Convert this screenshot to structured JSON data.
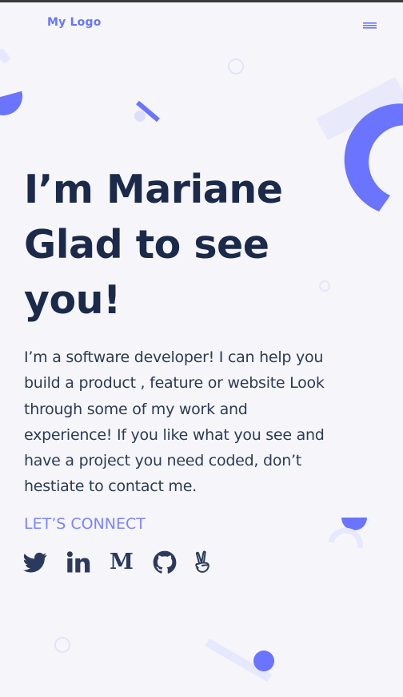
{
  "header": {
    "logo_text": "My Logo",
    "menu_icon": "hamburger-menu-icon"
  },
  "hero": {
    "title_lines": [
      "I’m Mariane",
      "Glad to see",
      "you!"
    ],
    "description_lines": [
      "I’m a software developer! I can help you",
      "build a product , feature or website Look",
      "through some of my work and",
      "experience! If you like what you see and",
      "have a project you need coded, don’t",
      "hestiate to contact me."
    ],
    "connect_label": "LET’S CONNECT"
  },
  "socials": [
    {
      "name": "twitter",
      "icon": "twitter-icon"
    },
    {
      "name": "linkedin",
      "icon": "linkedin-icon"
    },
    {
      "name": "medium",
      "icon": "medium-icon",
      "glyph": "M"
    },
    {
      "name": "github",
      "icon": "github-icon"
    },
    {
      "name": "angellist",
      "icon": "angellist-icon"
    }
  ],
  "colors": {
    "background": "#f6f6fa",
    "accent": "#6a74ff",
    "accent_light": "#e6e8fd",
    "text_dark": "#1b2a4a",
    "text_body": "#2c3a55",
    "connect": "#7b84ff",
    "icon": "#2b3a5c"
  }
}
